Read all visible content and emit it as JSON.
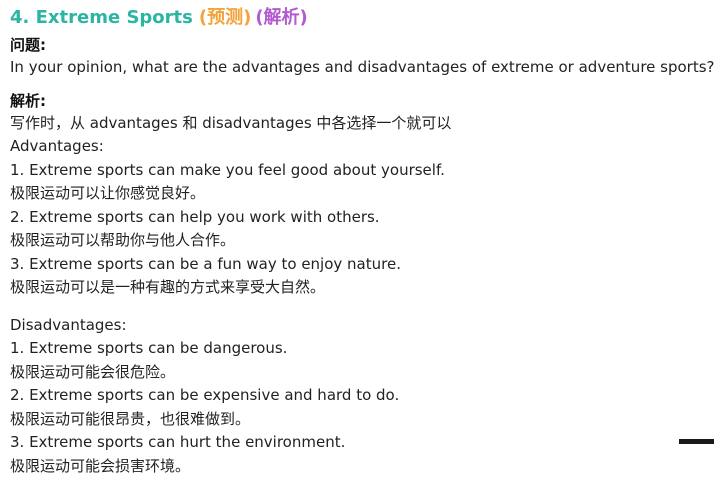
{
  "title": {
    "number_topic": "4. Extreme Sports",
    "tag_predict": "(预测)",
    "tag_analysis": "(解析)"
  },
  "question": {
    "heading": "问题:",
    "text": "In your opinion, what are the advantages and disadvantages of extreme or adventure sports?"
  },
  "analysis": {
    "heading": "解析:",
    "intro": "写作时，从 advantages 和 disadvantages 中各选择一个就可以",
    "advantages_label": "Advantages:",
    "advantages": [
      "1. Extreme sports can make you feel good about yourself.",
      "极限运动可以让你感觉良好。",
      "2. Extreme sports can help you work with others.",
      "极限运动可以帮助你与他人合作。",
      "3. Extreme sports can be a fun way to enjoy nature.",
      "极限运动可以是一种有趣的方式来享受大自然。"
    ],
    "disadvantages_label": "Disadvantages:",
    "disadvantages": [
      "1. Extreme sports can be dangerous.",
      "极限运动可能会很危险。",
      "2. Extreme sports can be expensive and hard to do.",
      "极限运动可能很昂贵，也很难做到。",
      "3. Extreme sports can hurt the environment.",
      "极限运动可能会损害环境。"
    ]
  }
}
